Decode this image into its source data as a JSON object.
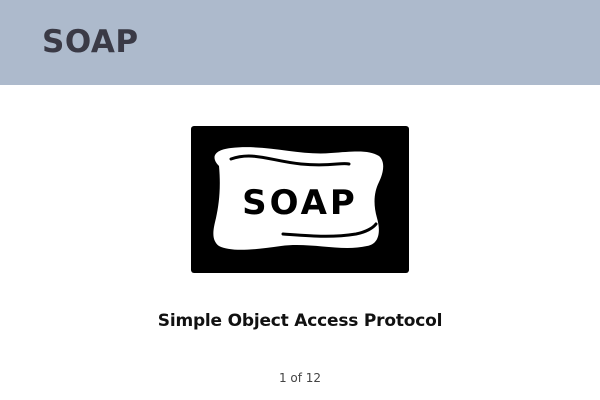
{
  "header": {
    "title": "SOAP",
    "background": "#adbacc"
  },
  "logo": {
    "icon": "soap-bar-icon",
    "label": "SOAP"
  },
  "content": {
    "subtitle": "Simple Object Access Protocol"
  },
  "pager": {
    "text": "1 of 12"
  }
}
